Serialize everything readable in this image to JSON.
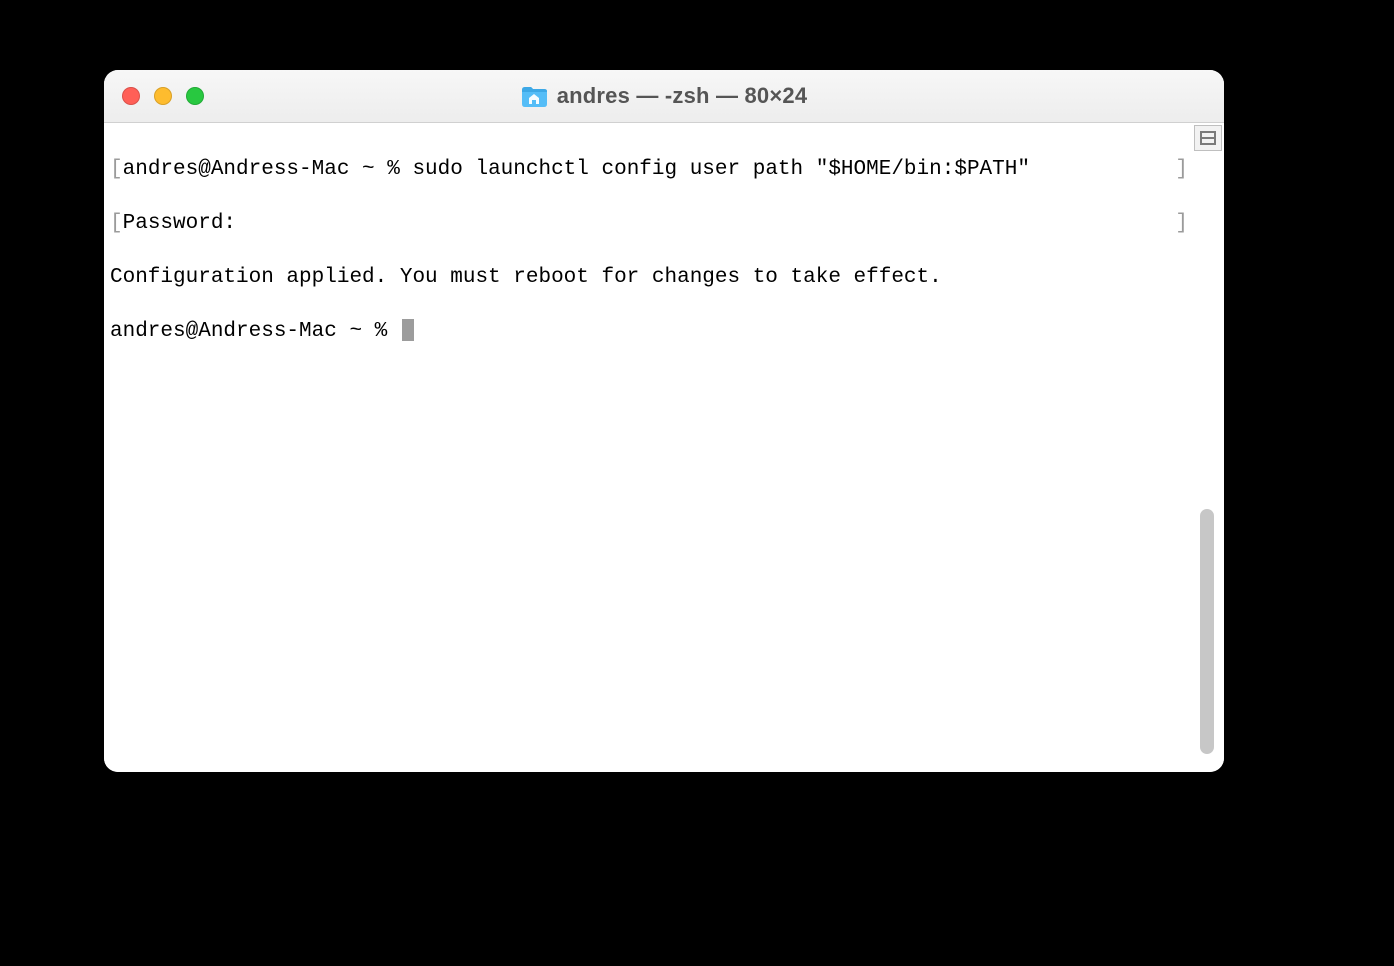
{
  "window": {
    "title": "andres — -zsh — 80×24"
  },
  "terminal": {
    "lines": {
      "l1_left_bracket": "[",
      "l1_text": "andres@Andress-Mac ~ % sudo launchctl config user path \"$HOME/bin:$PATH\"",
      "l1_right_bracket": "]",
      "l2_left_bracket": "[",
      "l2_text": "Password:",
      "l2_right_bracket": "]",
      "l3_text": "Configuration applied. You must reboot for changes to take effect.",
      "l4_prompt": "andres@Andress-Mac ~ % "
    }
  },
  "scrollbar": {
    "thumb_top_pct": 58,
    "thumb_height_pct": 40
  }
}
